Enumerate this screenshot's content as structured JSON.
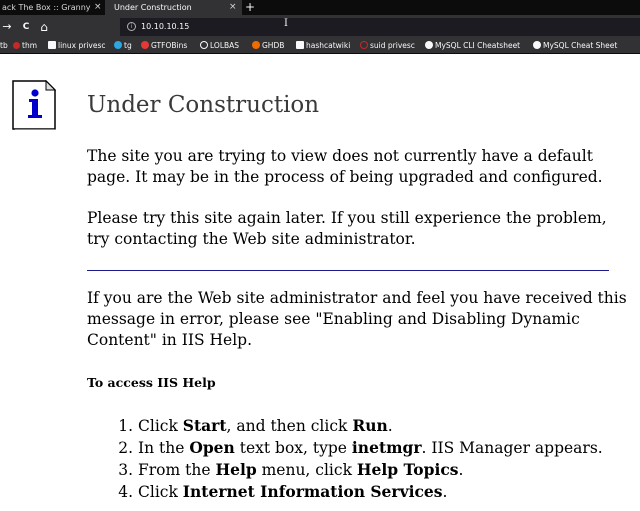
{
  "browser": {
    "tabs": [
      {
        "title": "ack The Box :: Granny",
        "close": "×"
      },
      {
        "title": "Under Construction",
        "close": "×"
      }
    ],
    "new_tab": "+",
    "nav": {
      "back": "→",
      "reload": "C",
      "home": "⌂"
    },
    "url": "10.10.10.15",
    "url_info": "i",
    "bookmarks": [
      {
        "label": "tb",
        "color": "#323234"
      },
      {
        "label": "thm",
        "color": "#c62828"
      },
      {
        "label": "linux privesc",
        "color": "#f9f9fa"
      },
      {
        "label": "tg",
        "color": "#2ea6e0"
      },
      {
        "label": "GTFOBins",
        "color": "#e53935"
      },
      {
        "label": "LOLBAS",
        "color": "#f9f9fa"
      },
      {
        "label": "GHDB",
        "color": "#ef6c00"
      },
      {
        "label": "hashcatwiki",
        "color": "#f9f9fa"
      },
      {
        "label": "suid privesc",
        "color": "#c62828"
      },
      {
        "label": "MySQL CLI Cheatsheet",
        "color": "#f9f9fa"
      },
      {
        "label": "MySQL Cheat Sheet",
        "color": "#f9f9fa"
      }
    ]
  },
  "page": {
    "heading": "Under Construction",
    "paragraph1": "The site you are trying to view does not currently have a default page. It may be in the process of being upgraded and configured.",
    "paragraph2": "Please try this site again later. If you still experience the problem, try contacting the Web site administrator.",
    "paragraph3": "If you are the Web site administrator and feel you have received this message in error, please see \"Enabling and Disabling Dynamic Content\" in IIS Help.",
    "subheading": "To access IIS Help",
    "steps": [
      {
        "before": "Click ",
        "b1": "Start",
        "mid": ", and then click ",
        "b2": "Run",
        "after": "."
      },
      {
        "before": "In the ",
        "b1": "Open",
        "mid": " text box, type ",
        "b2": "inetmgr",
        "after": ". IIS Manager appears."
      },
      {
        "before": "From the ",
        "b1": "Help",
        "mid": " menu, click ",
        "b2": "Help Topics",
        "after": "."
      },
      {
        "before": "Click ",
        "b1": "Internet Information Services",
        "mid": "",
        "b2": "",
        "after": "."
      }
    ]
  }
}
